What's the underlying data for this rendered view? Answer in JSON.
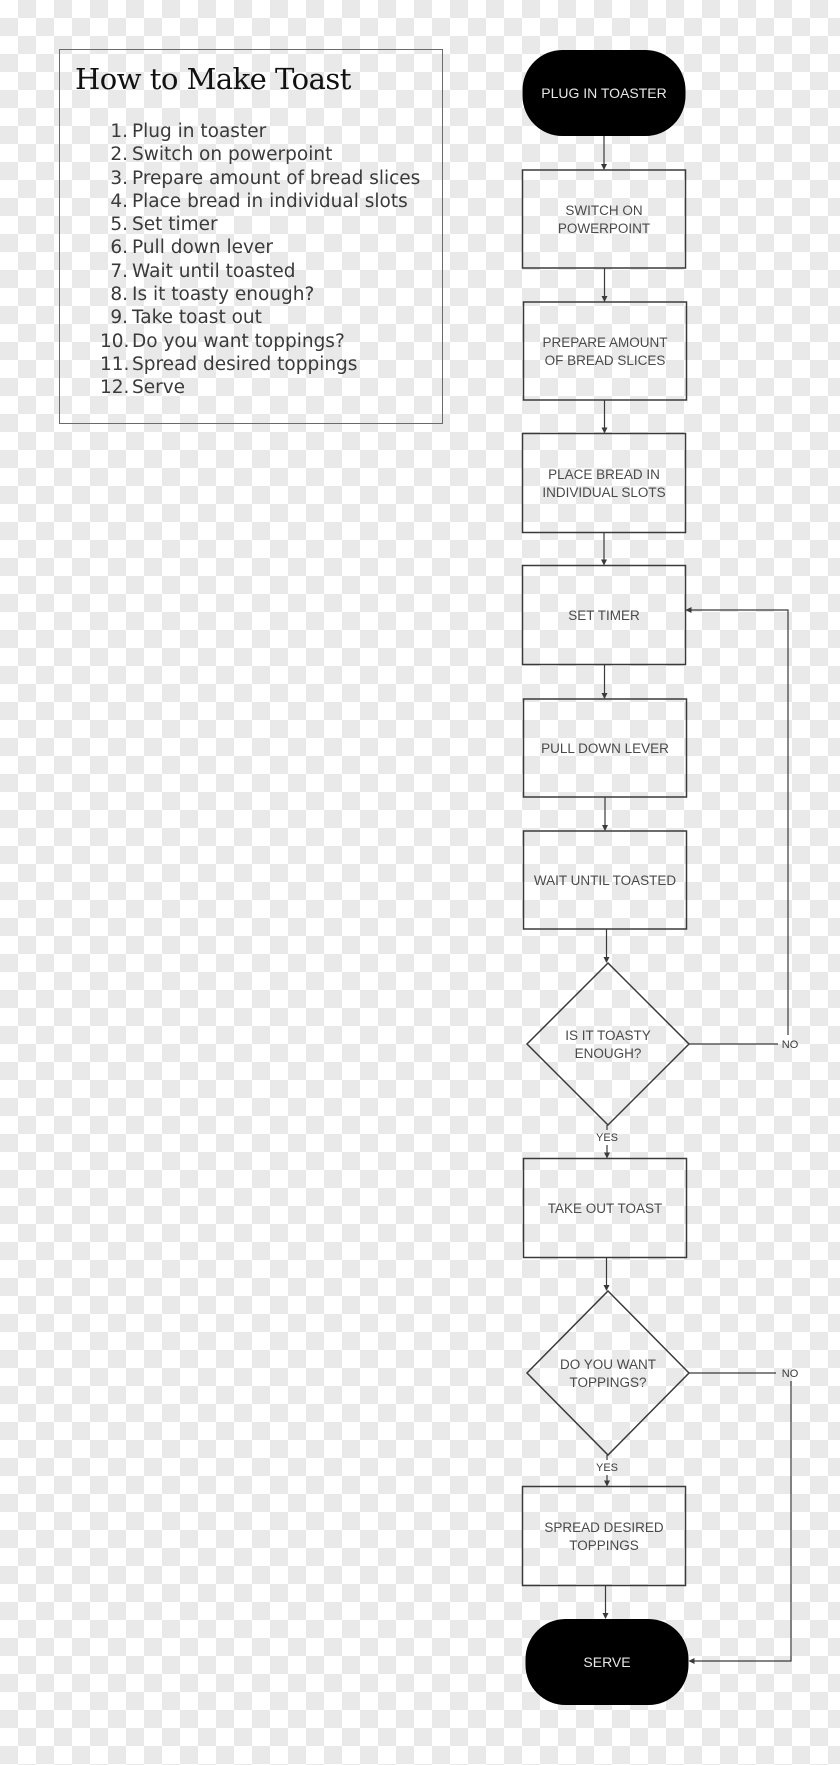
{
  "legend": {
    "title": "How to Make Toast",
    "steps": [
      {
        "num": "1.",
        "text": "Plug in toaster"
      },
      {
        "num": "2.",
        "text": "Switch on powerpoint"
      },
      {
        "num": "3.",
        "text": "Prepare amount of bread slices"
      },
      {
        "num": "4.",
        "text": "Place bread in individual slots"
      },
      {
        "num": "5.",
        "text": "Set timer"
      },
      {
        "num": "6.",
        "text": "Pull down lever"
      },
      {
        "num": "7.",
        "text": "Wait until toasted"
      },
      {
        "num": "8.",
        "text": "Is it toasty enough?"
      },
      {
        "num": "9.",
        "text": "Take toast out"
      },
      {
        "num": "10.",
        "text": "Do you want toppings?"
      },
      {
        "num": "11.",
        "text": "Spread desired toppings"
      },
      {
        "num": "12.",
        "text": "Serve"
      }
    ]
  },
  "flowchart": {
    "nodes": [
      {
        "id": "plug-in-toaster",
        "type": "terminal",
        "lines": [
          "PLUG IN TOASTER"
        ]
      },
      {
        "id": "switch-on-powerpoint",
        "type": "process",
        "lines": [
          "SWITCH ON",
          "POWERPOINT"
        ]
      },
      {
        "id": "prepare-bread",
        "type": "process",
        "lines": [
          "PREPARE AMOUNT",
          "OF BREAD SLICES"
        ]
      },
      {
        "id": "place-bread",
        "type": "process",
        "lines": [
          "PLACE BREAD IN",
          "INDIVIDUAL SLOTS"
        ]
      },
      {
        "id": "set-timer",
        "type": "process",
        "lines": [
          "SET TIMER"
        ]
      },
      {
        "id": "pull-down-lever",
        "type": "process",
        "lines": [
          "PULL DOWN LEVER"
        ]
      },
      {
        "id": "wait-until-toasted",
        "type": "process",
        "lines": [
          "WAIT UNTIL TOASTED"
        ]
      },
      {
        "id": "is-it-toasty",
        "type": "decision",
        "lines": [
          "IS IT TOASTY",
          "ENOUGH?"
        ]
      },
      {
        "id": "take-out-toast",
        "type": "process",
        "lines": [
          "TAKE OUT TOAST"
        ]
      },
      {
        "id": "want-toppings",
        "type": "decision",
        "lines": [
          "DO YOU WANT",
          "TOPPINGS?"
        ]
      },
      {
        "id": "spread-toppings",
        "type": "process",
        "lines": [
          "SPREAD DESIRED",
          "TOPPINGS"
        ]
      },
      {
        "id": "serve",
        "type": "terminal",
        "lines": [
          "SERVE"
        ]
      }
    ],
    "edges": [
      {
        "from": "plug-in-toaster",
        "to": "switch-on-powerpoint",
        "label": ""
      },
      {
        "from": "switch-on-powerpoint",
        "to": "prepare-bread",
        "label": ""
      },
      {
        "from": "prepare-bread",
        "to": "place-bread",
        "label": ""
      },
      {
        "from": "place-bread",
        "to": "set-timer",
        "label": ""
      },
      {
        "from": "set-timer",
        "to": "pull-down-lever",
        "label": ""
      },
      {
        "from": "pull-down-lever",
        "to": "wait-until-toasted",
        "label": ""
      },
      {
        "from": "wait-until-toasted",
        "to": "is-it-toasty",
        "label": ""
      },
      {
        "from": "is-it-toasty",
        "to": "take-out-toast",
        "label": "YES"
      },
      {
        "from": "is-it-toasty",
        "to": "set-timer",
        "label": "NO"
      },
      {
        "from": "take-out-toast",
        "to": "want-toppings",
        "label": ""
      },
      {
        "from": "want-toppings",
        "to": "spread-toppings",
        "label": "YES"
      },
      {
        "from": "want-toppings",
        "to": "serve",
        "label": "NO"
      },
      {
        "from": "spread-toppings",
        "to": "serve",
        "label": ""
      }
    ],
    "colors": {
      "terminal_fill": "#000000",
      "terminal_text": "#e6e6e6",
      "stroke": "#3a3a3a",
      "process_text": "#4a4a4a"
    }
  }
}
